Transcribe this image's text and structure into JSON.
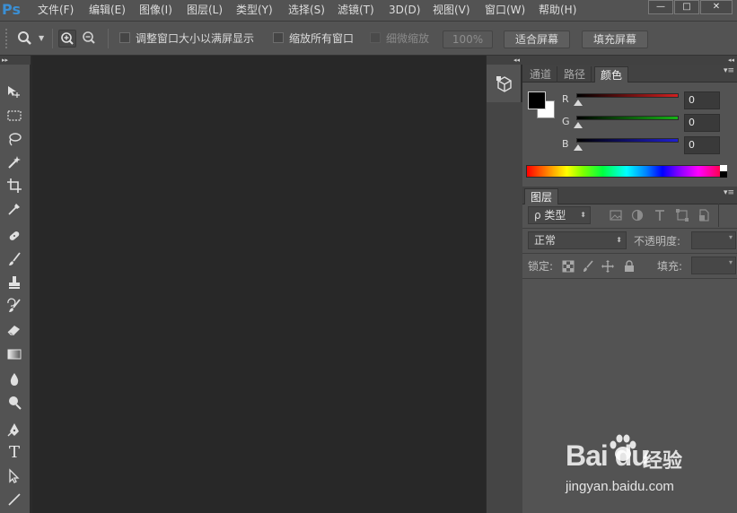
{
  "app": {
    "logo": "Ps"
  },
  "menu": {
    "items": [
      "文件(F)",
      "编辑(E)",
      "图像(I)",
      "图层(L)",
      "类型(Y)",
      "选择(S)",
      "滤镜(T)",
      "3D(D)",
      "视图(V)",
      "窗口(W)",
      "帮助(H)"
    ]
  },
  "window_controls": {
    "minimize": "—",
    "maximize": "□",
    "close": "✕"
  },
  "options_bar": {
    "resize_windows_label": "调整窗口大小以满屏显示",
    "zoom_all_windows_label": "缩放所有窗口",
    "scrubby_zoom_label": "细微缩放",
    "zoom_value": "100%",
    "fit_screen_label": "适合屏幕",
    "fill_screen_label": "填充屏幕"
  },
  "tool_panel": {
    "collapse_glyph": "▸▸",
    "tools": [
      "move-icon",
      "marquee-icon",
      "lasso-icon",
      "magic-wand-icon",
      "crop-icon",
      "eyedropper-icon",
      "healing-brush-icon",
      "brush-icon",
      "clone-stamp-icon",
      "history-brush-icon",
      "eraser-icon",
      "gradient-icon",
      "blur-icon",
      "dodge-icon",
      "pen-icon",
      "type-icon",
      "path-selection-icon",
      "line-icon"
    ],
    "type_tool_glyph": "T"
  },
  "right_panel": {
    "collapse_glyph": "◂◂",
    "panel_menu_glyph": "▾≡",
    "top_tabs": [
      "通道",
      "路径",
      "颜色"
    ],
    "active_top_tab": "颜色",
    "color": {
      "foreground": "#000000",
      "background": "#ffffff",
      "channels": [
        {
          "label": "R",
          "value": "0",
          "color": "#d11f1f"
        },
        {
          "label": "G",
          "value": "0",
          "color": "#16b316"
        },
        {
          "label": "B",
          "value": "0",
          "color": "#1f1fd1"
        }
      ]
    },
    "layers": {
      "tab_label": "图层",
      "filter_kind": "ρ 类型",
      "blend_mode": "正常",
      "opacity_label": "不透明度:",
      "lock_label": "锁定:",
      "fill_label": "填充:"
    }
  },
  "watermark": {
    "brand": "Bai du",
    "cn": "经验",
    "url": "jingyan.baidu.com"
  }
}
